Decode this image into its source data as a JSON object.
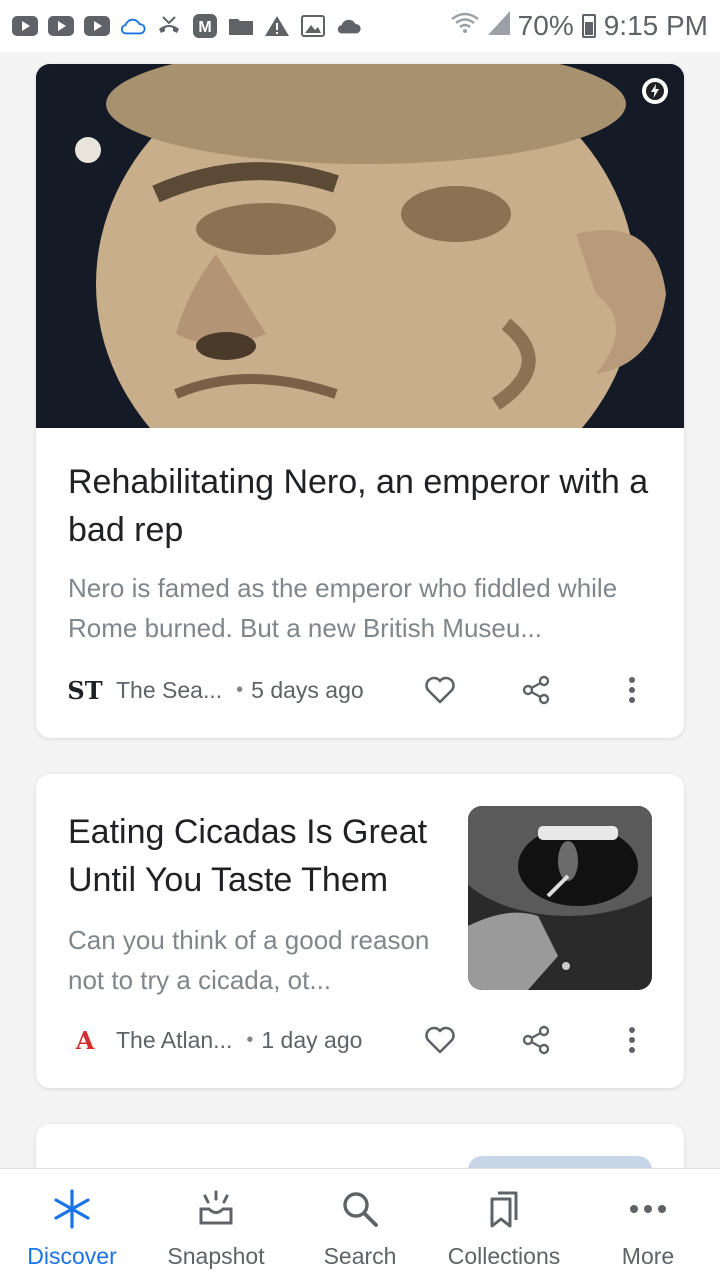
{
  "status_bar": {
    "battery": "70%",
    "time": "9:15 PM",
    "left_icons": [
      "youtube-icon",
      "youtube-icon",
      "youtube-icon",
      "cloud-outline-icon",
      "missed-call-icon",
      "m-app-icon",
      "folder-icon",
      "warning-icon",
      "image-icon",
      "cloud-icon"
    ],
    "right_icons": [
      "wifi-icon",
      "signal-icon",
      "battery-icon"
    ]
  },
  "feed": {
    "cards": [
      {
        "title": "Rehabilitating Nero, an emperor with a bad rep",
        "snippet": "Nero is famed as the emperor who fiddled while Rome burned. But a new British Museu...",
        "publisher": "The Sea...",
        "publisher_logo": "ST",
        "publisher_color": "#202124",
        "separator": "•",
        "time": "5 days ago",
        "image": "nero-bust-photo"
      },
      {
        "title": "Eating Cicadas Is Great Until You Taste Them",
        "snippet": "Can you think of a good reason not to try a cicada, ot...",
        "publisher": "The Atlan...",
        "publisher_logo": "A",
        "publisher_color": "#d32f2f",
        "separator": "•",
        "time": "1 day ago",
        "image": "cicada-mouth-photo"
      }
    ]
  },
  "bottom_nav": {
    "items": [
      {
        "label": "Discover",
        "icon": "asterisk-icon",
        "active": true
      },
      {
        "label": "Snapshot",
        "icon": "snapshot-icon",
        "active": false
      },
      {
        "label": "Search",
        "icon": "search-icon",
        "active": false
      },
      {
        "label": "Collections",
        "icon": "collections-icon",
        "active": false
      },
      {
        "label": "More",
        "icon": "more-horizontal-icon",
        "active": false
      }
    ]
  },
  "colors": {
    "accent": "#1a73e8",
    "text_primary": "#202124",
    "text_secondary": "#80868b",
    "icon_gray": "#5f6368"
  }
}
